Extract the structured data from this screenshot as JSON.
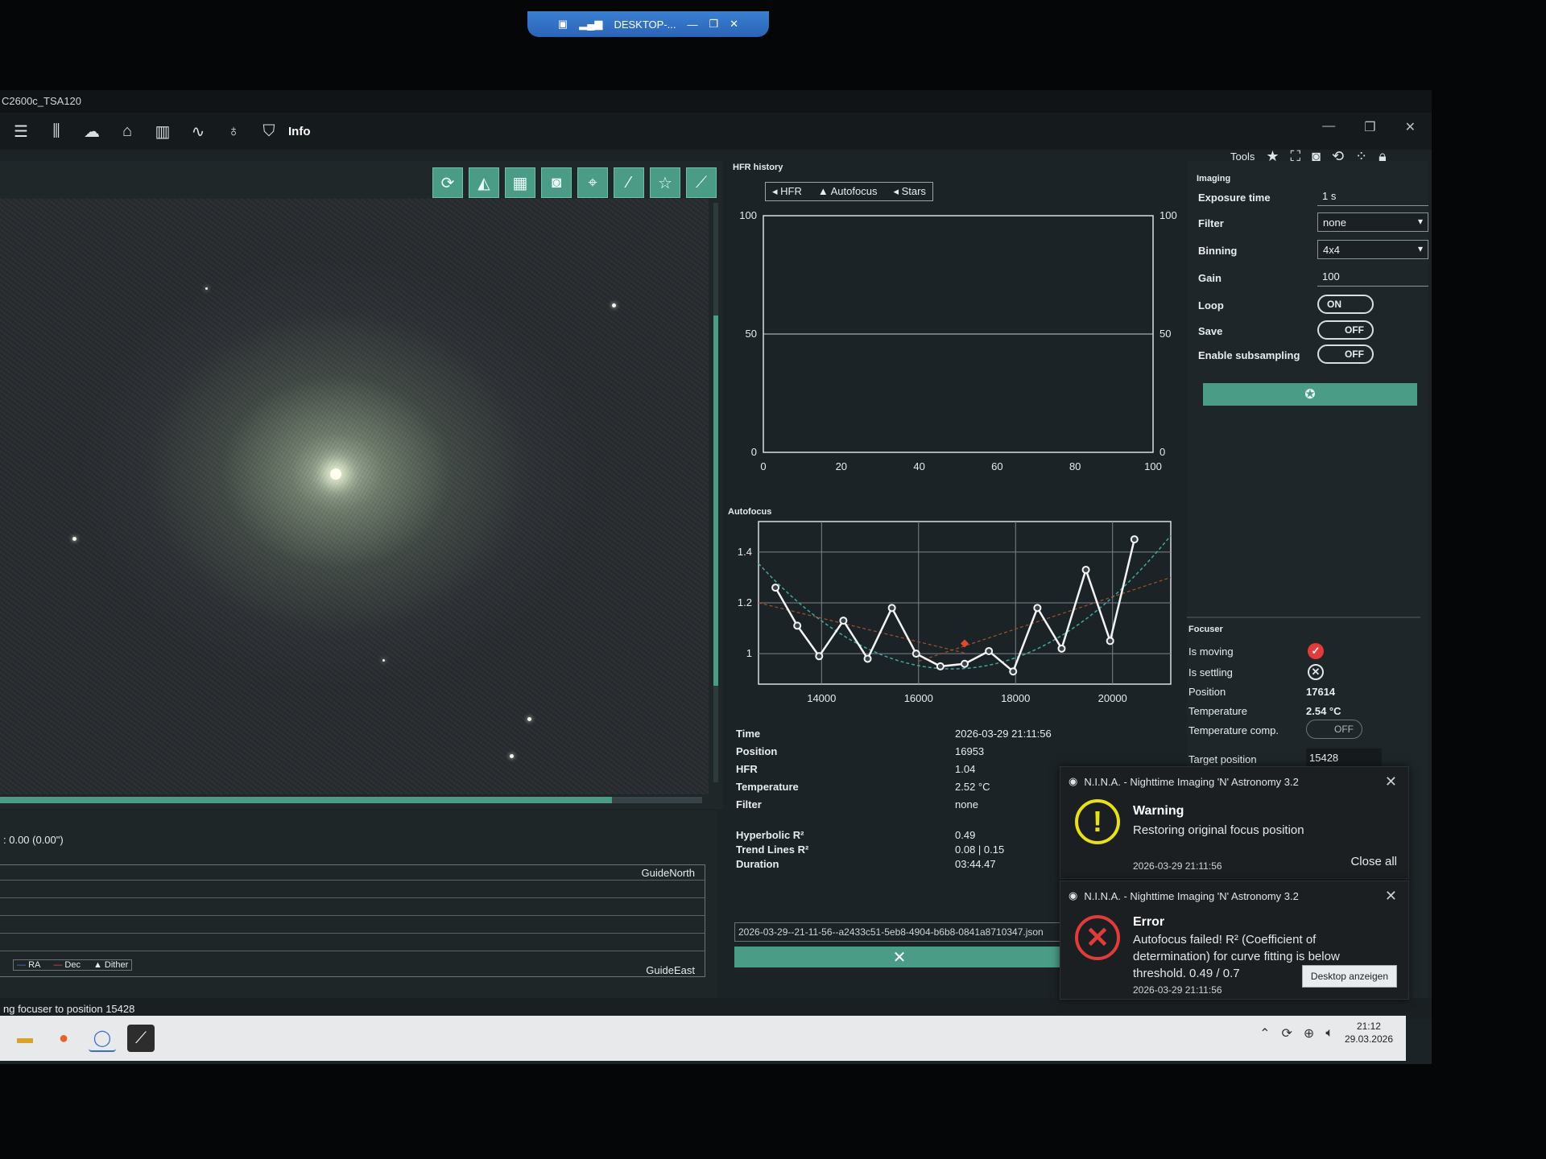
{
  "window": {
    "title": "C2600c_TSA120",
    "rdp_label": "DESKTOP-..."
  },
  "menubar": {
    "info_label": "Info",
    "icons": [
      "menu-icon",
      "equipment-icon",
      "weather-icon",
      "observatory-icon",
      "chart-icon",
      "guider-icon",
      "bulb-icon",
      "shield-icon"
    ]
  },
  "image_toolbar": {
    "buttons": [
      "rotate-icon",
      "flip-icon",
      "grid-icon",
      "frame-icon",
      "crosshair-icon",
      "magic-wand-icon",
      "star-icon",
      "telescope-icon"
    ]
  },
  "hfr": {
    "title": "HFR history",
    "legend": [
      "HFR",
      "Autofocus",
      "Stars"
    ],
    "x_ticks": [
      "0",
      "20",
      "40",
      "60",
      "80",
      "100"
    ],
    "y_ticks_left": [
      "0",
      "50",
      "100"
    ],
    "y_ticks_right": [
      "0",
      "50",
      "100"
    ]
  },
  "autofocus": {
    "title": "Autofocus",
    "x_ticks": [
      "14000",
      "16000",
      "18000",
      "20000"
    ],
    "y_ticks": [
      "1",
      "1.2",
      "1.4"
    ]
  },
  "af_info": {
    "time_label": "Time",
    "time": "2026-03-29 21:11:56",
    "position_label": "Position",
    "position": "16953",
    "hfr_label": "HFR",
    "hfr": "1.04",
    "temperature_label": "Temperature",
    "temperature": "2.52 °C",
    "filter_label": "Filter",
    "filter": "none",
    "hyperbolic_label": "Hyperbolic R²",
    "hyperbolic": "0.49",
    "trend_label": "Trend Lines R²",
    "trend": "0.08 | 0.15",
    "duration_label": "Duration",
    "duration": "03:44.47",
    "file": "2026-03-29--21-11-56--a2433c51-5eb8-4904-b6b8-0841a8710347.json"
  },
  "tools": {
    "label": "Tools"
  },
  "imaging": {
    "title": "Imaging",
    "exposure_label": "Exposure time",
    "exposure": "1  s",
    "filter_label": "Filter",
    "filter": "none",
    "binning_label": "Binning",
    "binning": "4x4",
    "gain_label": "Gain",
    "gain": "100",
    "loop_label": "Loop",
    "loop": "ON",
    "save_label": "Save",
    "save": "OFF",
    "subsampling_label": "Enable subsampling",
    "subsampling": "OFF"
  },
  "focuser": {
    "title": "Focuser",
    "moving_label": "Is moving",
    "settling_label": "Is settling",
    "position_label": "Position",
    "position": "17614",
    "temperature_label": "Temperature",
    "temperature": "2.54 °C",
    "tempcomp_label": "Temperature comp.",
    "tempcomp": "OFF",
    "target_label": "Target position",
    "target": "15428"
  },
  "guiding": {
    "rms": ": 0.00 (0.00\")",
    "north": "GuideNorth",
    "east": "GuideEast",
    "legend": [
      "RA",
      "Dec",
      "Dither"
    ]
  },
  "status": {
    "text": "ng focuser to position 15428"
  },
  "toasts": [
    {
      "app": "N.I.N.A. - Nighttime Imaging 'N' Astronomy 3.2",
      "title": "Warning",
      "message": "Restoring original focus position",
      "time": "2026-03-29 21:11:56",
      "action": "Close all"
    },
    {
      "app": "N.I.N.A. - Nighttime Imaging 'N' Astronomy 3.2",
      "title": "Error",
      "message": "Autofocus failed! R² (Coefficient of determination) for curve fitting is below threshold. 0.49 / 0.7",
      "time": "2026-03-29 21:11:56",
      "action": "Desktop anzeigen"
    }
  ],
  "taskbar": {
    "time": "21:12",
    "date": "29.03.2026"
  },
  "colors": {
    "accent": "#4b9c86",
    "warning": "#e8e01a",
    "error": "#e23b3b"
  },
  "chart_data": [
    {
      "type": "line",
      "title": "HFR history",
      "series": [
        {
          "name": "HFR",
          "values": []
        },
        {
          "name": "Autofocus",
          "values": []
        },
        {
          "name": "Stars",
          "values": []
        }
      ],
      "xlim": [
        0,
        100
      ],
      "ylim": [
        0,
        100
      ],
      "y2lim": [
        0,
        100
      ]
    },
    {
      "type": "scatter",
      "title": "Autofocus",
      "xlim": [
        12700,
        21200
      ],
      "ylim": [
        0.88,
        1.52
      ],
      "x": [
        13050,
        13500,
        13950,
        14450,
        14950,
        15450,
        15950,
        16450,
        16950,
        17450,
        17950,
        18450,
        18950,
        19450,
        19950,
        20450
      ],
      "y": [
        1.26,
        1.11,
        0.99,
        1.13,
        0.98,
        1.18,
        1.0,
        0.95,
        0.96,
        1.01,
        0.93,
        1.18,
        1.02,
        1.33,
        1.05,
        1.45
      ]
    }
  ]
}
